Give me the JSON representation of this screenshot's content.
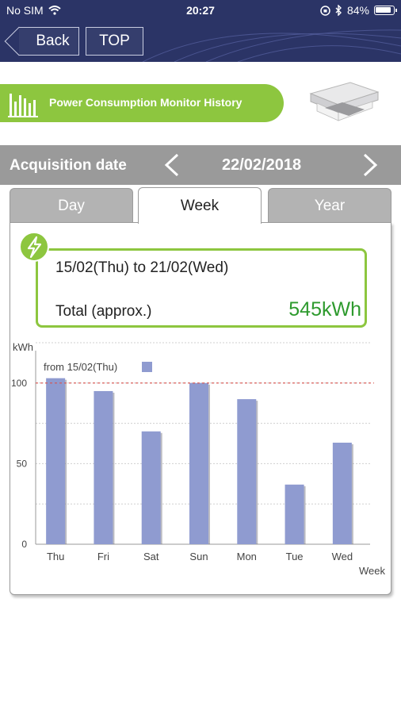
{
  "status_bar": {
    "carrier": "No SIM",
    "time": "20:27",
    "battery": "84%"
  },
  "nav": {
    "back_label": "Back",
    "top_label": "TOP"
  },
  "header": {
    "title": "Power Consumption Monitor History"
  },
  "date_bar": {
    "label": "Acquisition date",
    "value": "22/02/2018"
  },
  "tabs": [
    {
      "label": "Day",
      "selected": false
    },
    {
      "label": "Week",
      "selected": true
    },
    {
      "label": "Year",
      "selected": false
    }
  ],
  "summary": {
    "period": "15/02(Thu) to 21/02(Wed)",
    "total_label": "Total (approx.)",
    "total_value": "545kWh"
  },
  "colors": {
    "accent_green": "#8dc63f",
    "nav_blue": "#2b3466",
    "bar_color": "#8f9bd0",
    "total_text": "#2e9a2e",
    "reference_line": "#d9534f"
  },
  "chart_data": {
    "type": "bar",
    "categories": [
      "Thu",
      "Fri",
      "Sat",
      "Sun",
      "Mon",
      "Tue",
      "Wed"
    ],
    "series": [
      {
        "name": "from 15/02(Thu)",
        "values": [
          103,
          95,
          70,
          100,
          90,
          37,
          63
        ]
      }
    ],
    "ylabel": "kWh",
    "xlabel": "Week",
    "yticks": [
      0,
      50,
      100
    ],
    "ylim": [
      0,
      125
    ],
    "reference_line": 100,
    "grid": true,
    "legend_position": "top-left"
  }
}
